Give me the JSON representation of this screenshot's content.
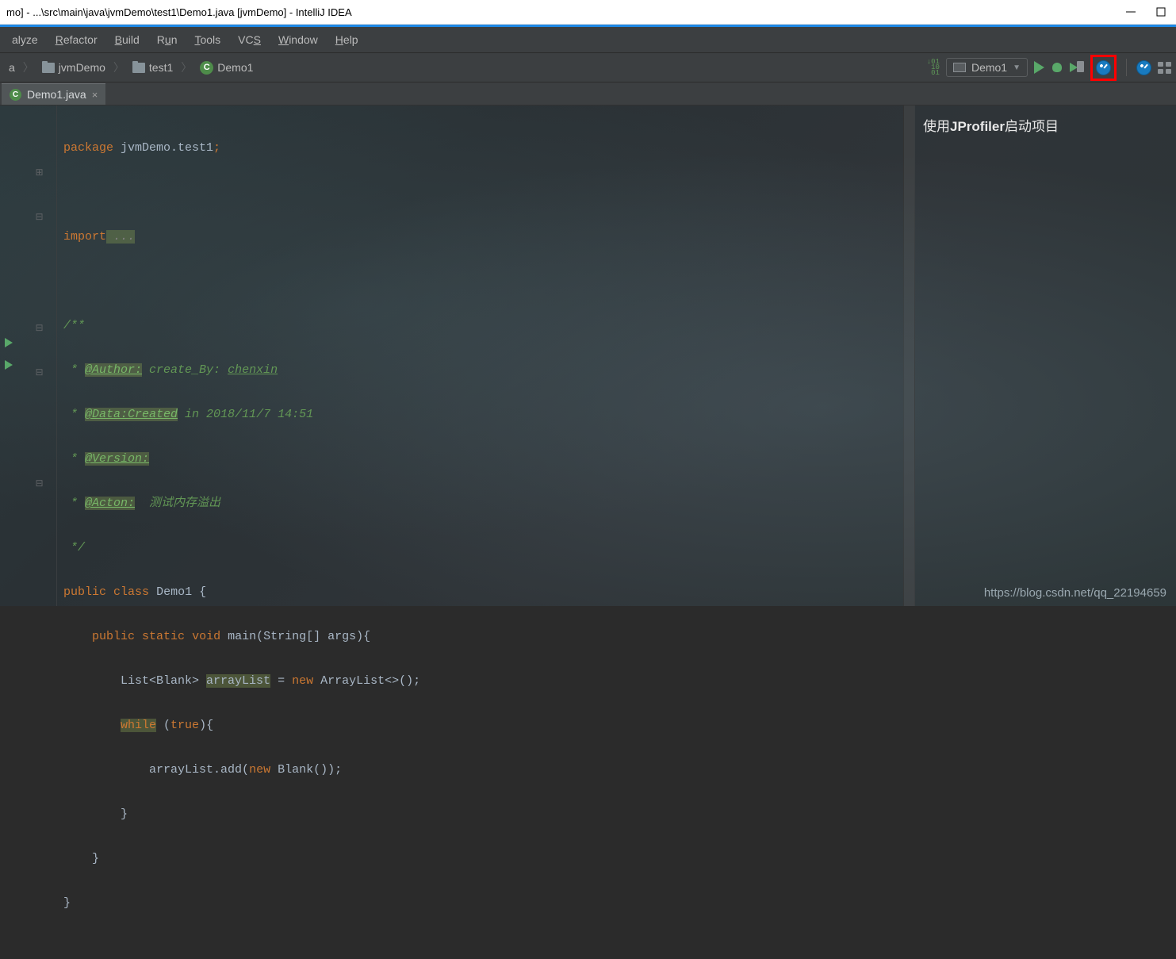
{
  "titlebar": {
    "text": "mo] - ...\\src\\main\\java\\jvmDemo\\test1\\Demo1.java [jvmDemo] - IntelliJ IDEA"
  },
  "menu": {
    "items": [
      "alyze",
      "Refactor",
      "Build",
      "Run",
      "Tools",
      "VCS",
      "Window",
      "Help"
    ]
  },
  "breadcrumbs": {
    "items": [
      {
        "label": "a",
        "icon": null
      },
      {
        "label": "jvmDemo",
        "icon": "folder"
      },
      {
        "label": "test1",
        "icon": "folder"
      },
      {
        "label": "Demo1",
        "icon": "class"
      }
    ],
    "sep": "〉"
  },
  "run_config": {
    "label": "Demo1"
  },
  "tabs": [
    {
      "label": "Demo1.java"
    }
  ],
  "annotation": {
    "prefix": "使用",
    "bold": "JProfiler",
    "suffix": "启动项目"
  },
  "code": {
    "package_kw": "package",
    "package_name": " jvmDemo.test1",
    "import_kw": "import",
    "import_rest": " ...",
    "doc_open": "/**",
    "doc_star": " * ",
    "author_tag": "@Author:",
    "author_rest": " create_By: ",
    "author_name": "chenxin",
    "data_tag": "@Data:Created",
    "data_rest": " in 2018/11/7 14:51",
    "version_tag": "@Version:",
    "acton_tag": "@Acton:",
    "acton_rest": "  测试内存溢出",
    "doc_close": " */",
    "public_kw": "public",
    "class_kw": "class",
    "class_name": "Demo1",
    "static_kw": "static",
    "void_kw": "void",
    "main_name": "main",
    "main_params": "(String[] args){",
    "list_type": "List<Blank> ",
    "arraylist_var": "arrayList",
    "eq": " = ",
    "new_kw": "new",
    "arraylist_ctor": " ArrayList<>();",
    "while_kw": "while",
    "true_kw": "true",
    "while_open": " (",
    "while_close": "){",
    "add_stmt_pre": "arrayList.add(",
    "add_stmt_post": " Blank());",
    "brace_close": "}"
  },
  "watermark": "https://blog.csdn.net/qq_22194659"
}
